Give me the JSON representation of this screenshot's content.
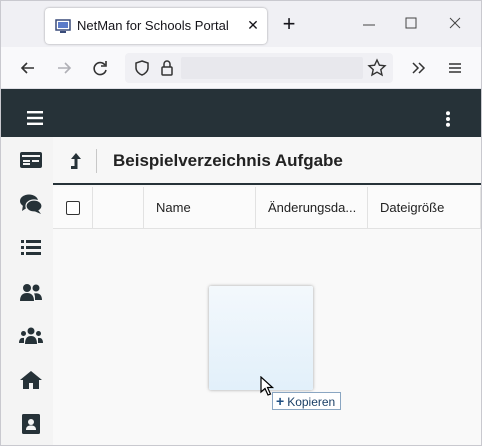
{
  "browser": {
    "tab_title": "NetMan for Schools Portal",
    "new_tab_label": "+",
    "close_tab_label": "✕"
  },
  "app": {
    "breadcrumb_title": "Beispielverzeichnis Aufgabe",
    "columns": [
      "Name",
      "Änderungsda...",
      "Dateigröße"
    ]
  },
  "sidebar": {
    "items": [
      "id-card-icon",
      "chat-icon",
      "list-icon",
      "user-group-icon",
      "users-icon",
      "home-icon",
      "contact-book-icon"
    ]
  },
  "drag": {
    "tooltip_label": "Kopieren",
    "tooltip_icon": "+"
  },
  "colors": {
    "appbar": "#263238",
    "ghost": "#e2f0fa",
    "tooltip_text": "#1a3f66"
  }
}
